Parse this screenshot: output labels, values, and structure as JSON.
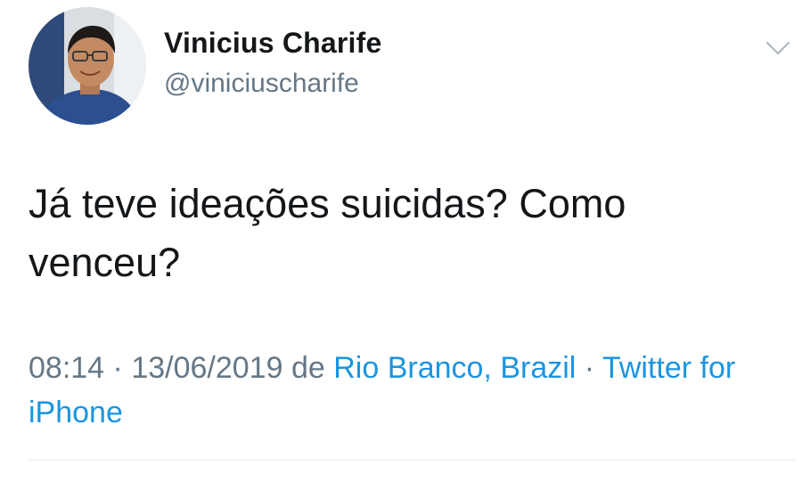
{
  "author": {
    "display_name": "Vinicius Charife",
    "handle": "@viniciuscharife"
  },
  "tweet": {
    "text": "Já teve ideações suicidas? Como venceu?"
  },
  "meta": {
    "time": "08:14",
    "date": "13/06/2019",
    "from_label": "de",
    "location": "Rio Branco, Brazil",
    "separator": "·",
    "source": "Twitter for iPhone"
  },
  "icons": {
    "menu": "chevron-down-icon"
  },
  "colors": {
    "text": "#14171a",
    "secondary": "#657786",
    "link": "#1b95e0",
    "divider": "#e6ecf0"
  }
}
